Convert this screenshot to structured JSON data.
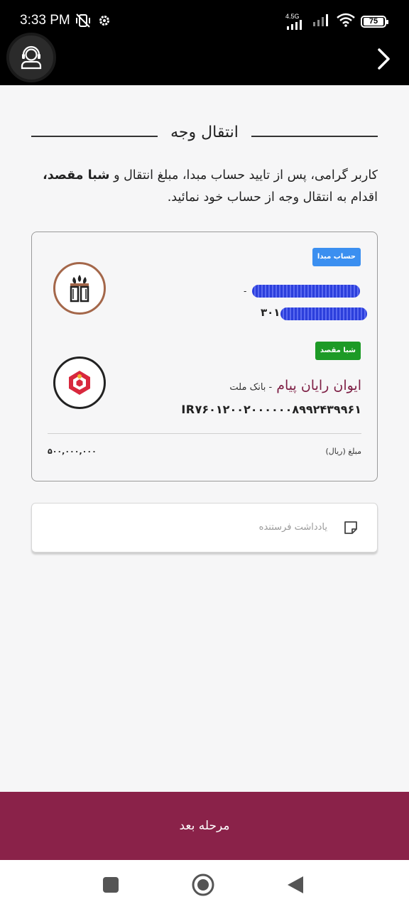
{
  "status_bar": {
    "time": "3:33 PM",
    "network_label": "4.5G",
    "battery": "75",
    "icons": [
      "mute-vibrate-icon",
      "settings-gear-icon",
      "signal-icon",
      "wifi-icon",
      "battery-icon"
    ]
  },
  "header": {
    "support_icon": "support-agent-icon",
    "back_icon": "chevron-right-icon"
  },
  "page": {
    "title": "انتقال وجه",
    "intro_part1": "کاربر گرامی، پس از تایید حساب مبدا، مبلغ انتقال و ",
    "intro_bold": "شبا مقصد،",
    "intro_part2": " اقدام به انتقال وجه از حساب خود نمائید."
  },
  "transfer": {
    "source_badge": "حساب مبدا",
    "source_dash": "-",
    "source_suffix": "۳۰۱",
    "dest_badge": "شبا مقصد",
    "dest_name": "ایوان رایان پیام",
    "dest_bank": "- بانک ملت",
    "iban": "IR۷۶۰۱۲۰۰۲۰۰۰۰۰۰۸۹۹۲۴۳۹۹۶۱",
    "amount_label": "مبلغ (ریال)",
    "amount_value": "۵۰۰,۰۰۰,۰۰۰"
  },
  "note": {
    "placeholder": "یادداشت فرستنده",
    "icon": "note-icon"
  },
  "actions": {
    "next_label": "مرحله بعد"
  },
  "colors": {
    "primary": "#8a2249",
    "source_badge": "#3b8ff0",
    "dest_badge": "#1d9a26",
    "dest_name": "#7d1e44"
  }
}
